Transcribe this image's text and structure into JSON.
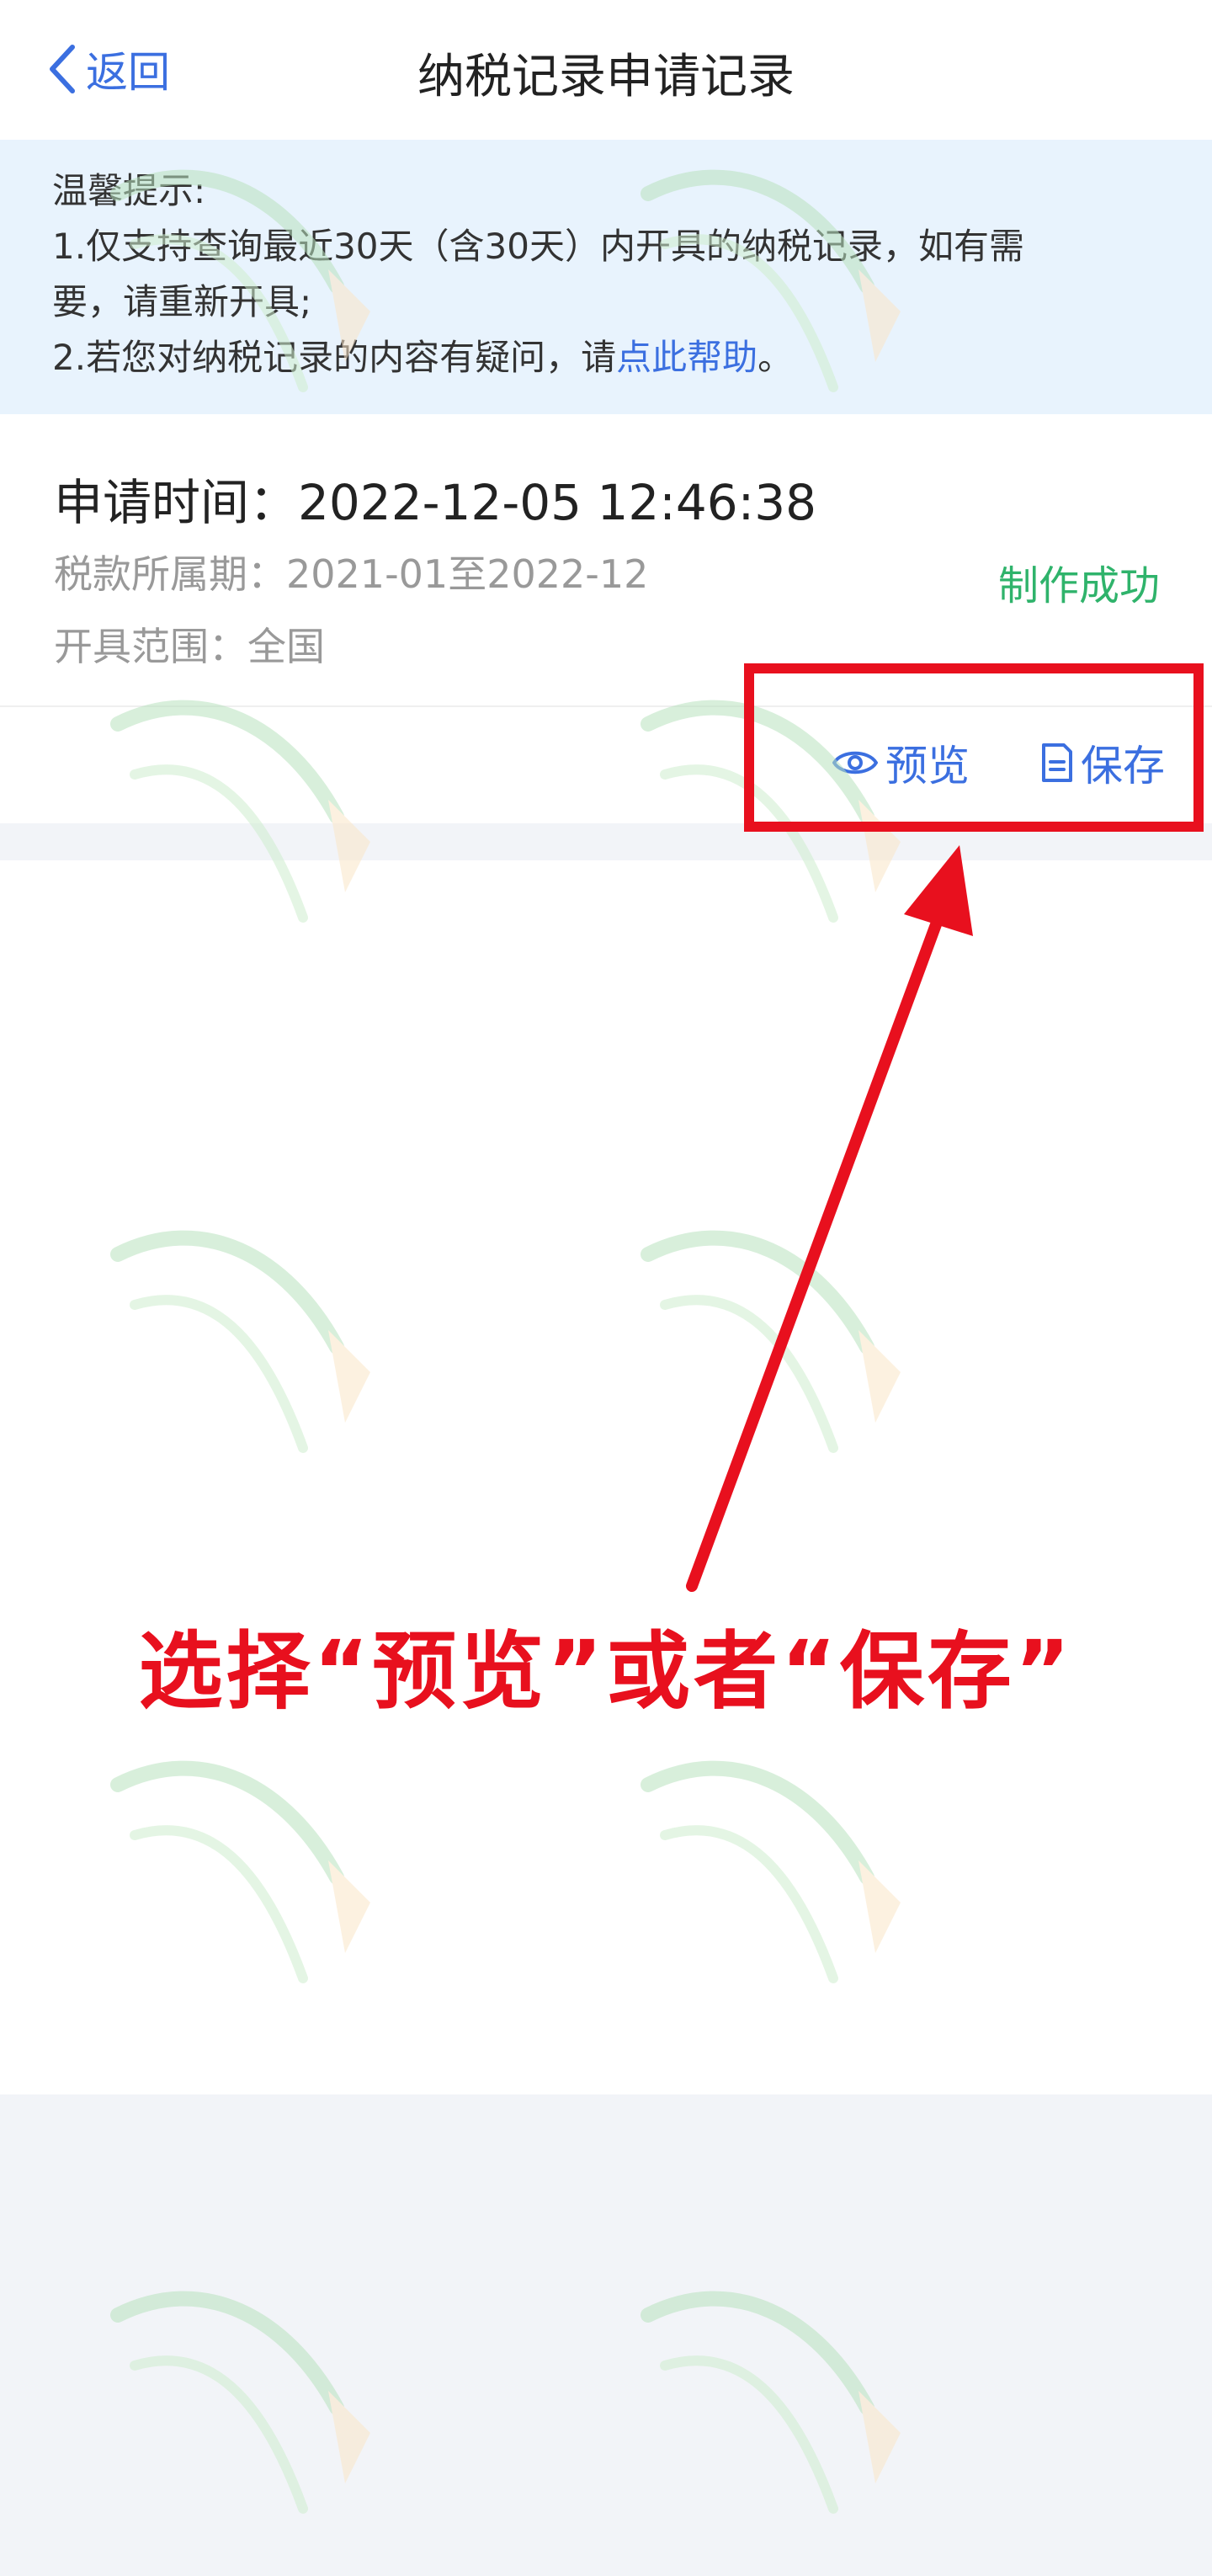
{
  "header": {
    "back_label": "返回",
    "title": "纳税记录申请记录"
  },
  "notice": {
    "heading": "温馨提示:",
    "line1": "1.仅支持查询最近30天（含30天）内开具的纳税记录，如有需",
    "line2": "要，请重新开具;",
    "line3_prefix": "2.若您对纳税记录的内容有疑问，请",
    "line3_link": "点此帮助",
    "line3_suffix": "。"
  },
  "record": {
    "apply_time": "申请时间：2022-12-05 12:46:38",
    "tax_period": "税款所属期：2021-01至2022-12",
    "issue_scope": "开具范围：全国",
    "status": "制作成功",
    "status_color": "#2fb36b",
    "actions": {
      "preview_label": "预览",
      "preview_icon": "eye-icon",
      "save_label": "保存",
      "save_icon": "document-icon"
    }
  },
  "annotation": {
    "text": "选择“预览”或者“保存”",
    "color": "#e8101e"
  },
  "colors": {
    "accent": "#3b6fe0",
    "notice_bg": "#e8f3fd",
    "page_bg": "#f2f4f8"
  }
}
